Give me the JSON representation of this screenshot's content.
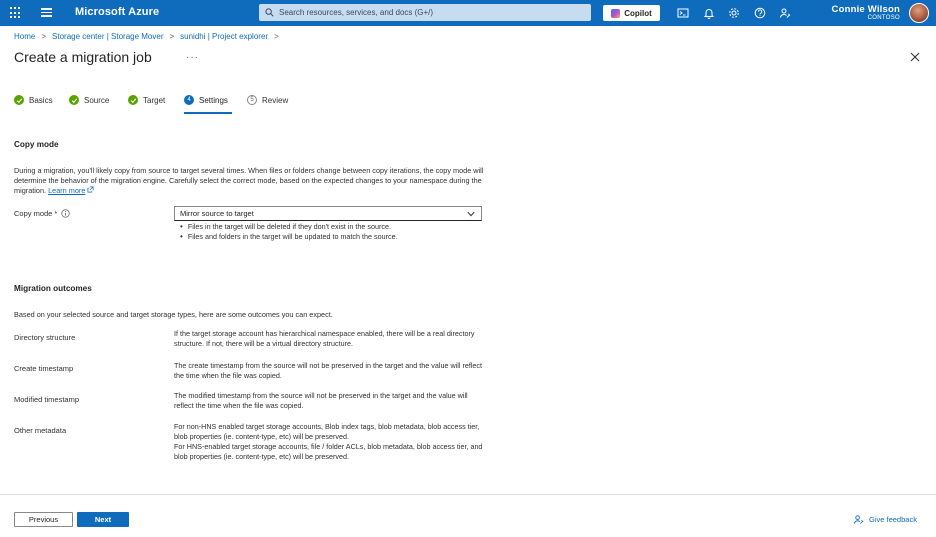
{
  "topbar": {
    "brand": "Microsoft Azure",
    "search_placeholder": "Search resources, services, and docs (G+/)",
    "copilot_label": "Copilot",
    "user_name": "Connie Wilson",
    "user_org": "CONTOSO"
  },
  "breadcrumb": [
    "Home",
    "Storage center | Storage Mover",
    "sunidhi | Project explorer"
  ],
  "page_title": "Create a migration job",
  "more_label": "···",
  "steps": [
    {
      "label": "Basics",
      "state": "done"
    },
    {
      "label": "Source",
      "state": "done"
    },
    {
      "label": "Target",
      "state": "done"
    },
    {
      "label": "Settings",
      "state": "current",
      "number": "4"
    },
    {
      "label": "Review",
      "state": "pending",
      "number": "5"
    }
  ],
  "copy_mode": {
    "title": "Copy mode",
    "description": "During a migration, you'll likely copy from source to target several times. When files or folders change between copy iterations, the copy mode will determine the behavior of the migration engine. Carefully select the correct mode, based on the expected changes to your namespace during the migration.",
    "learn_more": "Learn more",
    "field_label": "Copy mode *",
    "selected_value": "Mirror source to target",
    "bullets": [
      "Files in the target will be deleted if they don't exist in the source.",
      "Files and folders in the target will be updated to match the source."
    ]
  },
  "outcomes": {
    "title": "Migration outcomes",
    "intro": "Based on your selected source and target storage types, here are some outcomes you can expect.",
    "rows": [
      {
        "label": "Directory structure",
        "value": "If the target storage account has hierarchical namespace enabled, there will be a real directory structure. If not, there will be a virtual directory structure."
      },
      {
        "label": "Create timestamp",
        "value": "The create timestamp from the source will not be preserved in the target and the value will reflect the time when the file was copied."
      },
      {
        "label": "Modified timestamp",
        "value": "The modified timestamp from the source will not be preserved in the target and the value will reflect the time when the file was copied."
      },
      {
        "label": "Other metadata",
        "value": "For non-HNS enabled target storage accounts, Blob index tags, blob metadata, blob access tier, blob properties (ie. content-type, etc) will be preserved.",
        "value2": "For HNS-enabled target storage accounts, file / folder ACLs, blob metadata, blob access tier, and blob properties (ie. content-type, etc) will be preserved."
      }
    ]
  },
  "footer": {
    "previous": "Previous",
    "next": "Next",
    "feedback": "Give feedback"
  },
  "colors": {
    "accent": "#0f6cbd",
    "success": "#57a300"
  }
}
